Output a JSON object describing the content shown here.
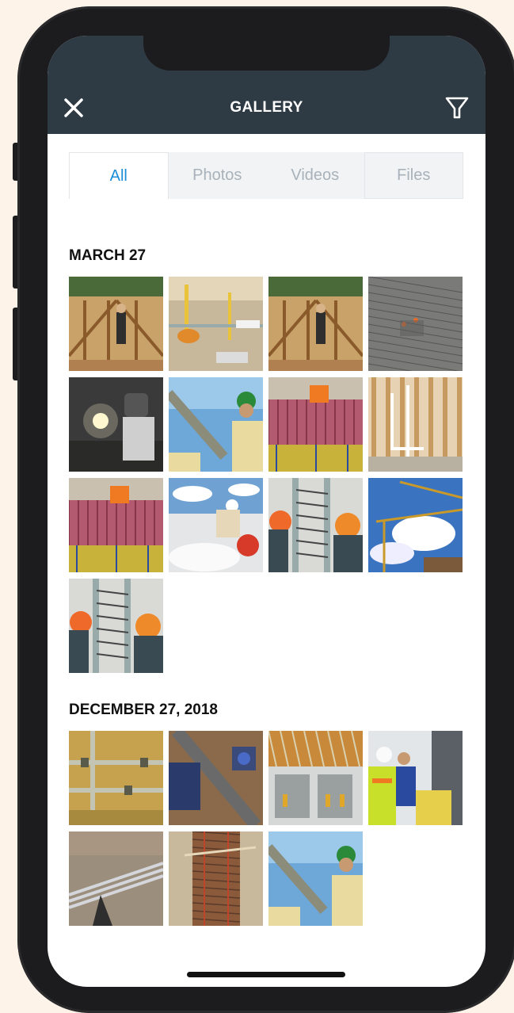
{
  "header": {
    "title": "GALLERY"
  },
  "tabs": [
    {
      "label": "All"
    },
    {
      "label": "Photos"
    },
    {
      "label": "Videos"
    },
    {
      "label": "Files"
    }
  ],
  "sections": [
    {
      "title": "MARCH 27",
      "photos": [
        "roof-trusses",
        "crane-site",
        "roof-trusses",
        "rebar-field",
        "welder",
        "worker-pipe",
        "rebar-bucket",
        "framing-interior",
        "rebar-bucket",
        "concrete-saw",
        "electrical-workers",
        "cranes-sky",
        "electrical-workers"
      ]
    },
    {
      "title": "DECEMBER 27, 2018",
      "photos": [
        "wall-pipes",
        "pipe-trench",
        "electrical-panel",
        "workers-vests",
        "conduit-ground",
        "rebar-trench",
        "worker-pipe"
      ]
    }
  ],
  "colors": {
    "header_bg": "#2e3a44",
    "accent": "#1a8fd8"
  }
}
